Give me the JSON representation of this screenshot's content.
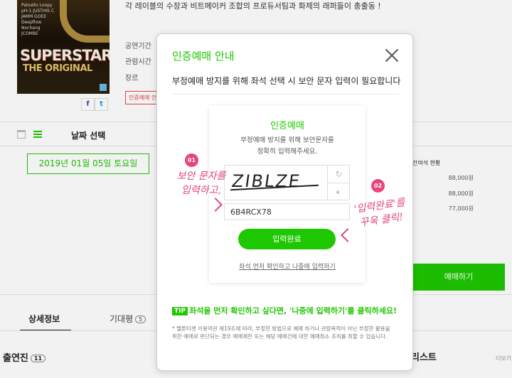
{
  "background": {
    "description_text": "각 레이블의 수장과 비트메이커 조합의 프로듀서팀과 화제의 래퍼들이 총출동 !",
    "poster": {
      "title_line1": "SUPERSTAR",
      "title_line2": "THE ORIGINAL",
      "small_text": "Paloalto Loopy pH-1 JUSTHIS C JAMM GOEE Deepflow Nochang JCOMBE"
    },
    "share": {
      "facebook": "f",
      "twitter": "t"
    },
    "info_labels": [
      "공연기간",
      "관람시간",
      "장르"
    ],
    "red_badge": "인증예매 안",
    "date_select_label": "날짜 선택",
    "selected_date": "2019년 01월 05일 토요일",
    "seat_status_title": "잔여석 현황",
    "prices": [
      "88,000원",
      "88,000원",
      "77,000원"
    ],
    "book_button": "예매하기",
    "tabs": {
      "detail": "상세정보",
      "expect": "기대평",
      "expect_count": "5"
    },
    "cast_title": "출연진",
    "cast_count": "11",
    "list_title": "리스트",
    "more_label": "더보기"
  },
  "modal": {
    "title": "인증예매 안내",
    "subtitle": "부정예매 방지를 위해 좌석 선택 시 보안 문자 입력이 필요합니다",
    "card": {
      "title": "인증예매",
      "desc_line1": "부정예매 방지를 위해 보안문자를",
      "desc_line2": "정확히 입력해주세요.",
      "captcha_image_text": "ZIBLZE",
      "input_value": "6B4RCX78",
      "submit_label": "입력완료",
      "later_link": "좌석 먼저 확인하고 나중에 입력하기"
    },
    "tip_badge": "TIP",
    "tip_text": "좌석을 먼저 확인하고 싶다면, '나중에 입력하기'를 클릭하세요!",
    "note": "* 멜론티켓 이용약관 제19조에 따라, 부정한 방법으로 예매 하거나 관람목적이 아닌 부정한 활용을 위한 예매로 판단되는 경우 예매제한 또는 해당 예매건에 대한 예매취소 조치를 취할 수 있습니다."
  },
  "annotations": {
    "step1": "01",
    "step1_line1": "보안 문자를",
    "step1_line2": "입력하고,",
    "step2": "02",
    "step2_line1": "'입력완료'를",
    "step2_line2": "꾸욱 클릭!"
  },
  "colors": {
    "accent": "#1ec800",
    "annotation": "#e0457d"
  }
}
